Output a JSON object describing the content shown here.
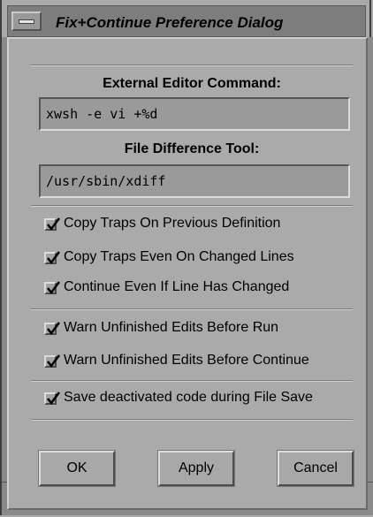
{
  "window": {
    "title": "Fix+Continue Preference Dialog"
  },
  "editor": {
    "label": "External Editor Command:",
    "value": "xwsh -e vi +%d"
  },
  "diff": {
    "label": "File Difference Tool:",
    "value": "/usr/sbin/xdiff"
  },
  "options": [
    {
      "label": "Copy Traps On Previous Definition",
      "checked": true
    },
    {
      "label": "Copy Traps Even On Changed Lines",
      "checked": true
    },
    {
      "label": "Continue Even If Line Has Changed",
      "checked": true
    },
    {
      "label": "Warn Unfinished Edits Before Run",
      "checked": true
    },
    {
      "label": "Warn Unfinished Edits Before Continue",
      "checked": true
    },
    {
      "label": "Save deactivated code during File Save",
      "checked": true
    }
  ],
  "buttons": {
    "ok": "OK",
    "apply": "Apply",
    "cancel": "Cancel"
  },
  "colors": {
    "background": "#aaaaaa",
    "titlebar": "#7d7d7d",
    "field": "#9a9a9a"
  }
}
